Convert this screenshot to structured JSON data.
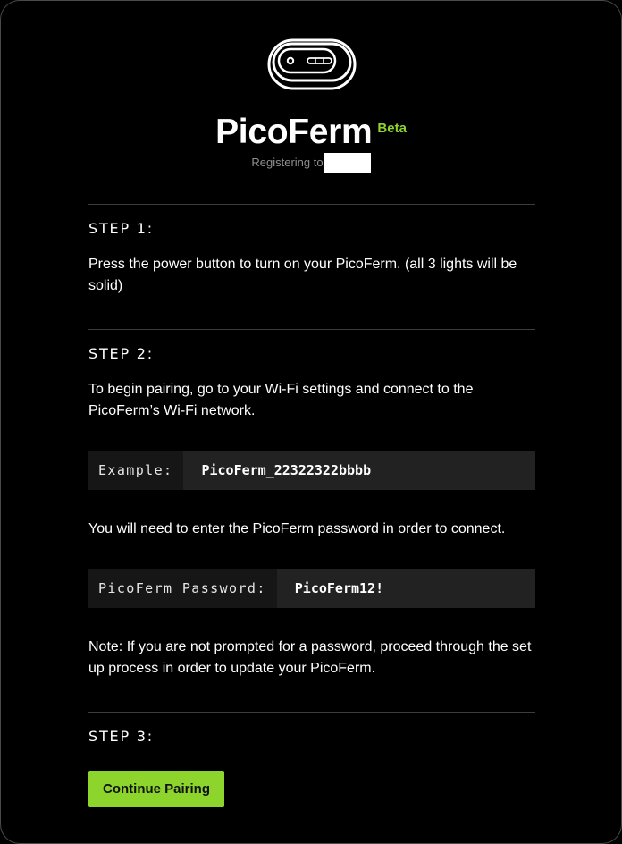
{
  "brand": {
    "name": "PicoFerm",
    "badge": "Beta",
    "registering_label": "Registering to",
    "logo_icon": "picoferm-device-icon"
  },
  "steps": [
    {
      "title": "STEP 1:",
      "text": "Press the power button to turn on your PicoFerm. (all 3 lights will be solid)"
    },
    {
      "title": "STEP 2:",
      "text": "To begin pairing, go to your Wi-Fi settings and connect to the PicoFerm’s Wi-Fi network.",
      "example_label": "Example:",
      "example_value": "PicoFerm_22322322bbbb",
      "password_intro": "You will need to enter the PicoFerm password in order to connect.",
      "password_label": "PicoFerm Password:",
      "password_value": "PicoFerm12!",
      "note": "Note: If you are not prompted for a password, proceed through the set up process in order to update your PicoFerm."
    },
    {
      "title": "STEP 3:",
      "button_label": "Continue Pairing"
    }
  ],
  "colors": {
    "accent": "#8dd52c",
    "background": "#000000",
    "code_background": "#222222"
  }
}
